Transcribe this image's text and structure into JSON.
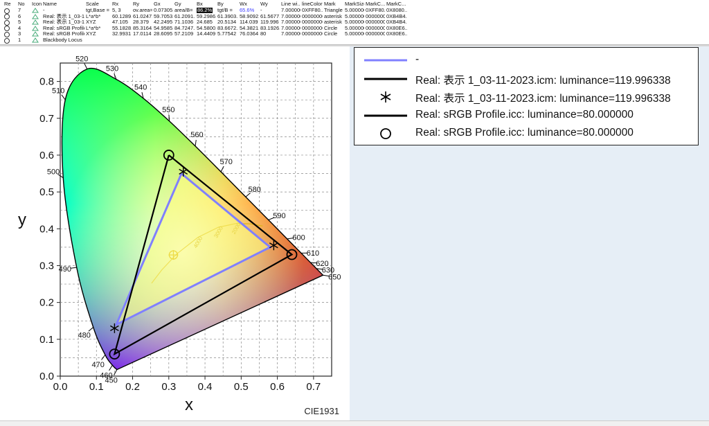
{
  "table": {
    "columns": [
      "Re",
      "No",
      "Icon",
      "Name",
      "Scale",
      "Rx",
      "Ry",
      "Gx",
      "Gy",
      "Bx",
      "By",
      "Wx",
      "Wy",
      "Line wi...",
      "lineColor",
      "Mark",
      "MarkSize",
      "MarkC...",
      "MarkC..."
    ],
    "rows": [
      [
        "",
        "7",
        "",
        "-",
        "tgt,Base =",
        "5, 3",
        "ov.area=",
        "0.07305...",
        "area/B=",
        "86.2%",
        "tgt/B =",
        "65.6%",
        "-",
        "7.000000",
        "0XFF80...",
        "Triangle",
        "5.000000",
        "0XFF80...",
        "0X8080..."
      ],
      [
        "",
        "6",
        "",
        "Real: 表示 1_03-11-...",
        "L*a*b*",
        "60.1289...",
        "61.0247...",
        "59.7053...",
        "61.2091...",
        "59.2986...",
        "61.3903...",
        "58.9092...",
        "61.5677...",
        "7.000000",
        "00000000",
        "asterisk",
        "5.000000",
        "00000000",
        "0XB4B4..."
      ],
      [
        "",
        "5",
        "",
        "Real: 表示 1_03-11-...",
        "XYZ",
        "47.105",
        "28.379",
        "42.2495",
        "71.1036",
        "24.685",
        "20.5134",
        "114.039",
        "119.996",
        "7.000000",
        "00000000",
        "asterisk",
        "5.000000",
        "00000000",
        "0XB4B4..."
      ],
      [
        "",
        "4",
        "",
        "Real: sRGB Profile.i...",
        "L*a*b*",
        "55.1828...",
        "85.3164...",
        "54.9585...",
        "84.7247...",
        "54.5800...",
        "83.6672...",
        "54.3821...",
        "83.1926...",
        "7.000000",
        "00000000",
        "Circle",
        "5.000000",
        "00000000",
        "0X80E6..."
      ],
      [
        "",
        "3",
        "",
        "Real: sRGB Profile.i...",
        "XYZ",
        "32.9931",
        "17.0114",
        "28.6095",
        "57.2109",
        "14.4409",
        "5.77542",
        "76.0364",
        "80",
        "7.000000",
        "00000000",
        "Circle",
        "5.000000",
        "00000000",
        "0X80E6..."
      ],
      [
        "",
        "1",
        "",
        "Blackbody Locus",
        "",
        "",
        "",
        "",
        "",
        "",
        "",
        "",
        "",
        "",
        "",
        "",
        "",
        "",
        ""
      ]
    ]
  },
  "legend": [
    {
      "label": "-",
      "symbol": "line",
      "color": "#8080ff"
    },
    {
      "label": "Real: 表示 1_03-11-2023.icm: luminance=119.996338",
      "symbol": "line",
      "color": "#000000"
    },
    {
      "label": "Real: 表示 1_03-11-2023.icm: luminance=119.996338",
      "symbol": "asterisk",
      "color": "#000000"
    },
    {
      "label": "Real: sRGB Profile.icc: luminance=80.000000",
      "symbol": "line",
      "color": "#000000"
    },
    {
      "label": "Real: sRGB Profile.icc: luminance=80.000000",
      "symbol": "circle",
      "color": "#000000"
    }
  ],
  "chart_data": {
    "type": "scatter",
    "title": "",
    "xlabel": "x",
    "ylabel": "y",
    "corner_label": "CIE1931",
    "xlim": [
      0.0,
      0.75
    ],
    "ylim": [
      0.0,
      0.85
    ],
    "xticks": [
      "0.0",
      "0.1",
      "0.2",
      "0.3",
      "0.4",
      "0.5",
      "0.6",
      "0.7"
    ],
    "yticks": [
      "0.0",
      "0.1",
      "0.2",
      "0.3",
      "0.4",
      "0.5",
      "0.6",
      "0.7",
      "0.8"
    ],
    "grid": true,
    "spectral_locus": {
      "wavelengths": [
        450,
        460,
        470,
        480,
        490,
        500,
        510,
        520,
        530,
        540,
        550,
        560,
        570,
        580,
        590,
        600,
        610,
        620,
        630,
        650
      ],
      "x": [
        0.1566,
        0.144,
        0.1241,
        0.0913,
        0.0454,
        0.0082,
        0.0139,
        0.0743,
        0.1547,
        0.2296,
        0.3016,
        0.3731,
        0.4441,
        0.5125,
        0.5752,
        0.627,
        0.6658,
        0.6915,
        0.7079,
        0.726
      ],
      "y": [
        0.0177,
        0.0297,
        0.0578,
        0.1327,
        0.295,
        0.5384,
        0.7502,
        0.8338,
        0.8059,
        0.7543,
        0.6923,
        0.6245,
        0.5547,
        0.4866,
        0.4242,
        0.3725,
        0.334,
        0.3083,
        0.292,
        0.274
      ],
      "labels": [
        "450",
        "460",
        "470",
        "480",
        "490",
        "500",
        "510",
        "520",
        "530",
        "540",
        "550",
        "560",
        "570",
        "580",
        "590",
        "600",
        "610",
        "620",
        "630",
        "650"
      ]
    },
    "series": [
      {
        "name": "-",
        "style": "polygon",
        "color": "#8080ff",
        "x": [
          0.335,
          0.58,
          0.155,
          0.335
        ],
        "y": [
          0.55,
          0.35,
          0.14,
          0.55
        ]
      },
      {
        "name": "Real: 表示 1_03-11-2023.icm: luminance=119.996338",
        "style": "marker",
        "marker": "asterisk",
        "color": "#000000",
        "x": [
          0.34,
          0.59,
          0.15
        ],
        "y": [
          0.555,
          0.355,
          0.13
        ]
      },
      {
        "name": "Real: sRGB Profile.icc: luminance=80.000000",
        "style": "polygon",
        "color": "#000000",
        "x": [
          0.3,
          0.64,
          0.15,
          0.3
        ],
        "y": [
          0.6,
          0.33,
          0.06,
          0.6
        ]
      },
      {
        "name": "Real: sRGB Profile.icc: luminance=80.000000",
        "style": "marker",
        "marker": "circle",
        "color": "#000000",
        "x": [
          0.3,
          0.64,
          0.15
        ],
        "y": [
          0.6,
          0.33,
          0.06
        ]
      }
    ],
    "white_point": {
      "x": 0.3127,
      "y": 0.329
    },
    "blackbody_locus": {
      "x": [
        0.2525,
        0.2807,
        0.3221,
        0.3805,
        0.4369,
        0.486,
        0.5267,
        0.5593
      ],
      "y": [
        0.2523,
        0.2884,
        0.3318,
        0.3768,
        0.4041,
        0.4144,
        0.4133,
        0.4075
      ],
      "labels": [
        "",
        "",
        "",
        "4000",
        "3000",
        "2000",
        "",
        ""
      ]
    }
  }
}
